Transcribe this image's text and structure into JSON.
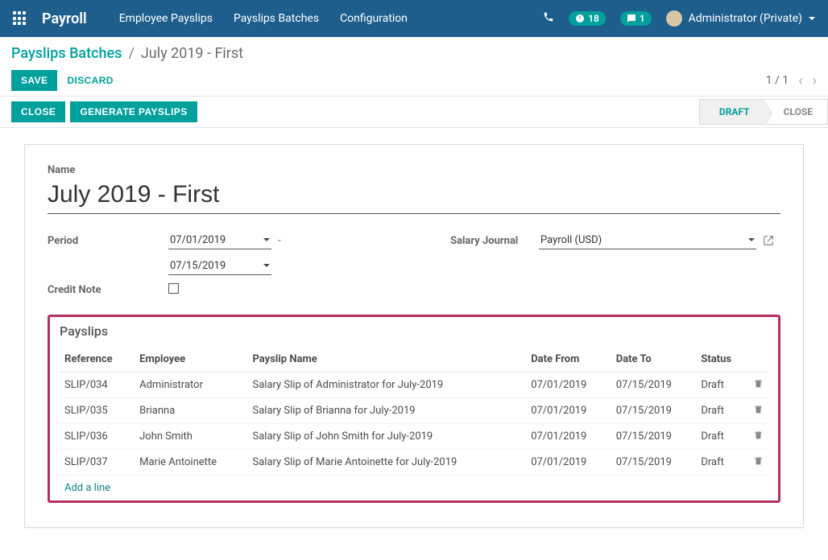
{
  "brand": "Payroll",
  "topnav_menu": [
    "Employee Payslips",
    "Payslips Batches",
    "Configuration"
  ],
  "topnav_badges": {
    "timer": "18",
    "messages": "1"
  },
  "user_label": "Administrator (Private)",
  "breadcrumb": {
    "parent": "Payslips Batches",
    "current": "July 2019 - First"
  },
  "buttons": {
    "save": "SAVE",
    "discard": "DISCARD",
    "close": "CLOSE",
    "generate": "GENERATE PAYSLIPS"
  },
  "pager": "1 / 1",
  "stages": {
    "draft": "DRAFT",
    "close": "CLOSE"
  },
  "labels": {
    "name": "Name",
    "period": "Period",
    "credit_note": "Credit Note",
    "salary_journal": "Salary Journal"
  },
  "form": {
    "name": "July 2019 - First",
    "date_from": "07/01/2019",
    "date_to": "07/15/2019",
    "credit_note": false,
    "salary_journal": "Payroll (USD)"
  },
  "payslips_title": "Payslips",
  "payslips_headers": {
    "reference": "Reference",
    "employee": "Employee",
    "payslip_name": "Payslip Name",
    "date_from": "Date From",
    "date_to": "Date To",
    "status": "Status"
  },
  "payslips": [
    {
      "reference": "SLIP/034",
      "employee": "Administrator",
      "name": "Salary Slip of Administrator for July-2019",
      "date_from": "07/01/2019",
      "date_to": "07/15/2019",
      "status": "Draft"
    },
    {
      "reference": "SLIP/035",
      "employee": "Brianna",
      "name": "Salary Slip of Brianna for July-2019",
      "date_from": "07/01/2019",
      "date_to": "07/15/2019",
      "status": "Draft"
    },
    {
      "reference": "SLIP/036",
      "employee": "John Smith",
      "name": "Salary Slip of John Smith for July-2019",
      "date_from": "07/01/2019",
      "date_to": "07/15/2019",
      "status": "Draft"
    },
    {
      "reference": "SLIP/037",
      "employee": "Marie Antoinette",
      "name": "Salary Slip of Marie Antoinette for July-2019",
      "date_from": "07/01/2019",
      "date_to": "07/15/2019",
      "status": "Draft"
    }
  ],
  "add_line": "Add a line"
}
